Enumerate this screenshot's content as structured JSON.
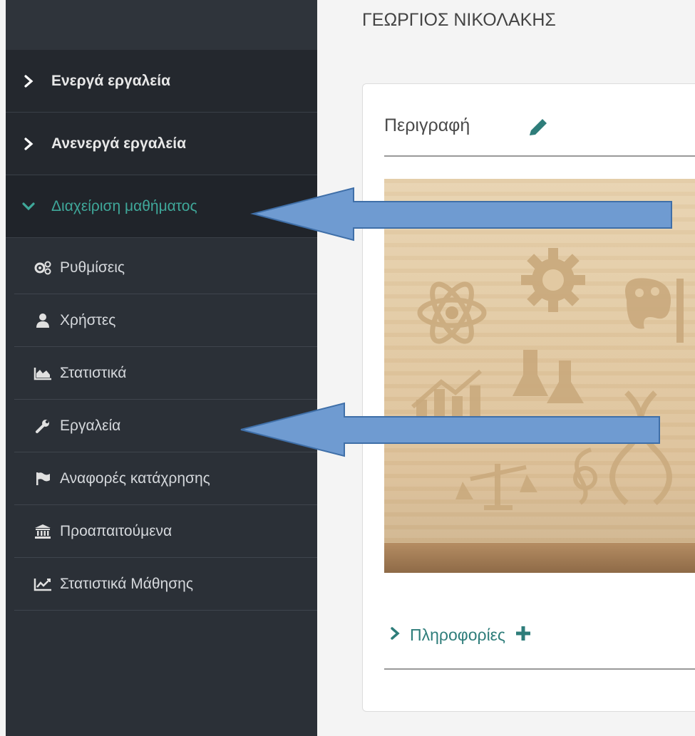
{
  "header": {
    "user_name": "ΓΕΩΡΓΙΟΣ ΝΙΚΟΛΑΚΗΣ"
  },
  "sidebar": {
    "groups": [
      {
        "label": "Ενεργά εργαλεία",
        "expanded": false
      },
      {
        "label": "Ανενεργά εργαλεία",
        "expanded": false
      },
      {
        "label": "Διαχείριση μαθήματος",
        "expanded": true
      }
    ],
    "sub_items": [
      {
        "label": "Ρυθμίσεις",
        "icon": "cogs-icon"
      },
      {
        "label": "Χρήστες",
        "icon": "user-icon"
      },
      {
        "label": "Στατιστικά",
        "icon": "area-chart-icon"
      },
      {
        "label": "Εργαλεία",
        "icon": "wrench-icon"
      },
      {
        "label": "Αναφορές κατάχρησης",
        "icon": "flag-icon"
      },
      {
        "label": "Προαπαιτούμενα",
        "icon": "institution-icon"
      },
      {
        "label": "Στατιστικά Μάθησης",
        "icon": "line-chart-icon"
      }
    ]
  },
  "card": {
    "title": "Περιγραφή",
    "info_label": "Πληροφορίες"
  },
  "colors": {
    "sidebar_bg": "#2b3037",
    "active_accent": "#3fa89a",
    "link_teal": "#2e7d7a",
    "arrow_fill": "#6f9bd1",
    "arrow_stroke": "#3f6fa8"
  }
}
